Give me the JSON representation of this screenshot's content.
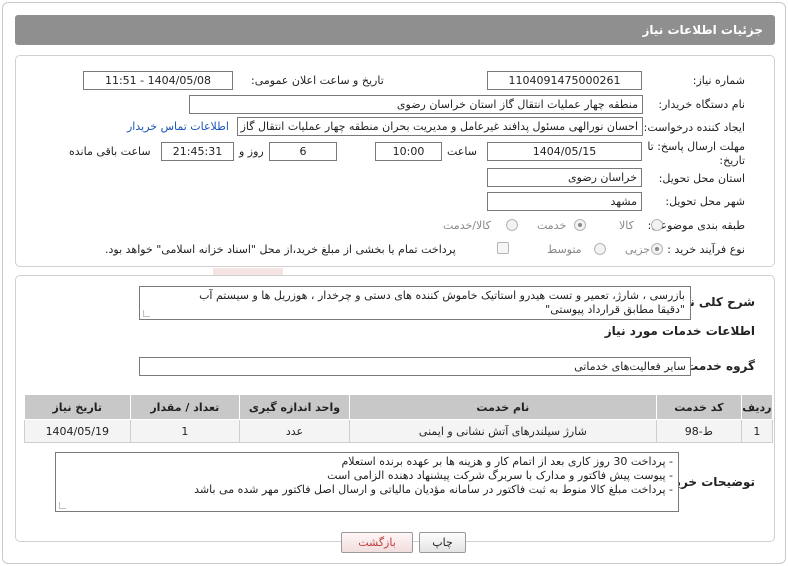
{
  "header": {
    "title": "جزئیات اطلاعات نیاز"
  },
  "form": {
    "need_number_label": "شماره نیاز:",
    "need_number": "1104091475000261",
    "announce_label": "تاریخ و ساعت اعلان عمومی:",
    "announce_value": "1404/05/08 - 11:51",
    "buyer_label": "نام دستگاه خریدار:",
    "buyer_value": "منطقه چهار عملیات انتقال گاز    استان خراسان رضوی",
    "creator_label": "ایجاد کننده درخواست:",
    "creator_value": "احسان نورالهی مسئول پدافند غیرعامل و مدیریت بحران منطقه چهار عملیات انتقال گاز",
    "contact_link": "اطلاعات تماس خریدار",
    "deadline_label_1": "مهلت ارسال پاسخ: تا",
    "deadline_label_2": "تاریخ:",
    "deadline_date": "1404/05/15",
    "time_label": "ساعت",
    "deadline_time": "10:00",
    "days_value": "6",
    "days_label": "روز و",
    "remaining_time": "21:45:31",
    "remaining_label": "ساعت باقی مانده",
    "province_label": "استان محل تحویل:",
    "province_value": "خراسان رضوی",
    "city_label": "شهر محل تحویل:",
    "city_value": "مشهد",
    "category_label": "طبقه بندی موضوعی:",
    "category_options": [
      "کالا",
      "خدمت",
      "کالا/خدمت"
    ],
    "category_selected": "خدمت",
    "process_label": "نوع فرآیند خرید :",
    "process_options": [
      "جزیی",
      "متوسط"
    ],
    "process_selected": "جزیی",
    "payment_note": "پرداخت تمام یا بخشی از مبلغ خرید،از محل \"اسناد خزانه اسلامی\" خواهد بود."
  },
  "summary": {
    "label": "شرح کلی نیاز:",
    "line1": "بازرسی ، شارژ، تعمیر و تست هیدرو استاتیک خاموش کننده های دستی و چرخدار ، هوزریل ها و سیستم آب",
    "line2": "\"دقیقا مطابق قرارداد پیوستی\""
  },
  "services": {
    "section_title": "اطلاعات خدمات مورد نیاز",
    "group_label": "گروه خدمت:",
    "group_value": "سایر فعالیت‌های خدماتی",
    "columns": [
      "ردیف",
      "کد خدمت",
      "نام خدمت",
      "واحد اندازه گیری",
      "تعداد / مقدار",
      "تاریخ نیاز"
    ],
    "rows": [
      {
        "row": "1",
        "code": "ط-98",
        "name": "شارژ سیلندرهای آتش نشانی و ایمنی",
        "unit": "عدد",
        "qty": "1",
        "date": "1404/05/19"
      }
    ]
  },
  "buyer_notes": {
    "label": "توضیحات خریدار:",
    "lines": [
      "- پرداخت 30 روز کاری بعد از اتمام کار و هزینه ها بر عهده برنده استعلام",
      "- پیوست پیش فاکتور و مدارک با سربرگ شرکت پیشنهاد دهنده الزامی است",
      "- پرداخت مبلغ کالا منوط به ثبت فاکتور در سامانه مؤدیان مالیاتی و ارسال اصل فاکتور مهر شده  می باشد"
    ]
  },
  "buttons": {
    "print": "چاپ",
    "back": "بازگشت"
  },
  "watermark": {
    "text": "AriaTender.neT"
  },
  "colors": {
    "header": "#8f8f8f",
    "link": "#1a56b8",
    "watermark": "#c0392b"
  }
}
